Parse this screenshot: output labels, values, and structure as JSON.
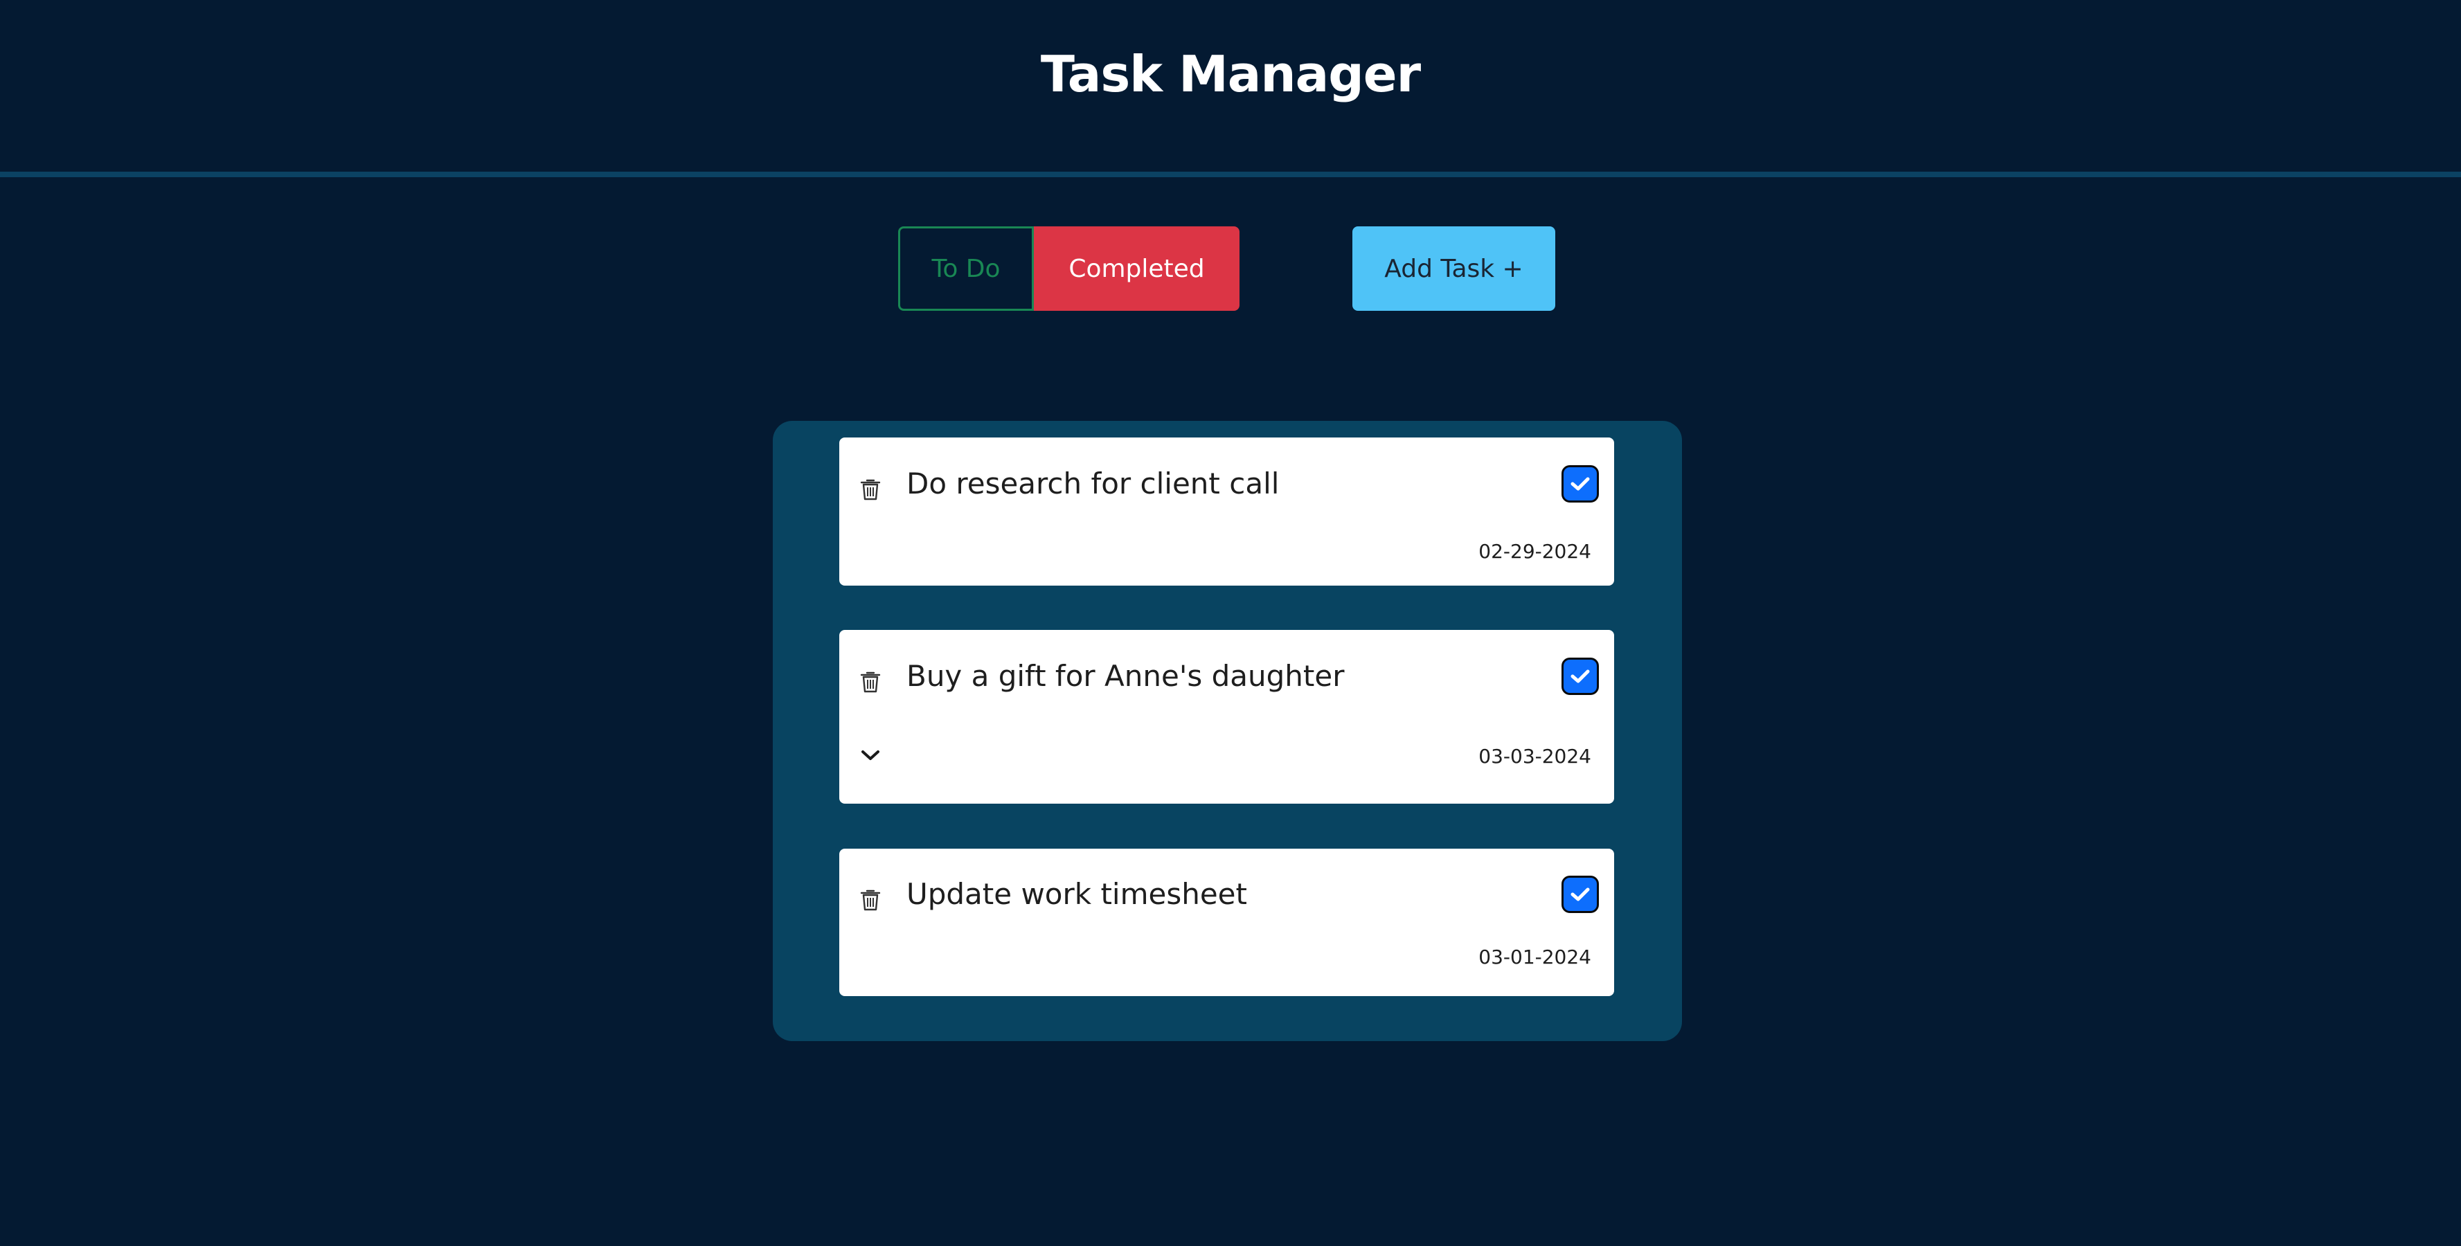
{
  "app": {
    "title": "Task Manager"
  },
  "filter": {
    "todo_label": "To Do",
    "completed_label": "Completed",
    "active": "Completed"
  },
  "toolbar": {
    "add_label": "Add Task +"
  },
  "tasks": [
    {
      "title": "Do research for client call",
      "date": "02-29-2024",
      "completed": true,
      "has_details": false
    },
    {
      "title": "Buy a gift for Anne's daughter",
      "date": "03-03-2024",
      "completed": true,
      "has_details": true
    },
    {
      "title": "Update work timesheet",
      "date": "03-01-2024",
      "completed": true,
      "has_details": false
    }
  ],
  "colors": {
    "background": "#041a32",
    "panel": "#084461",
    "todo_accent": "#198754",
    "completed_accent": "#dc3545",
    "add_button": "#4fc3f7",
    "checkbox": "#0d6efd"
  },
  "icons": {
    "delete": "trash-icon",
    "check": "check-icon",
    "expand": "chevron-down-icon"
  }
}
